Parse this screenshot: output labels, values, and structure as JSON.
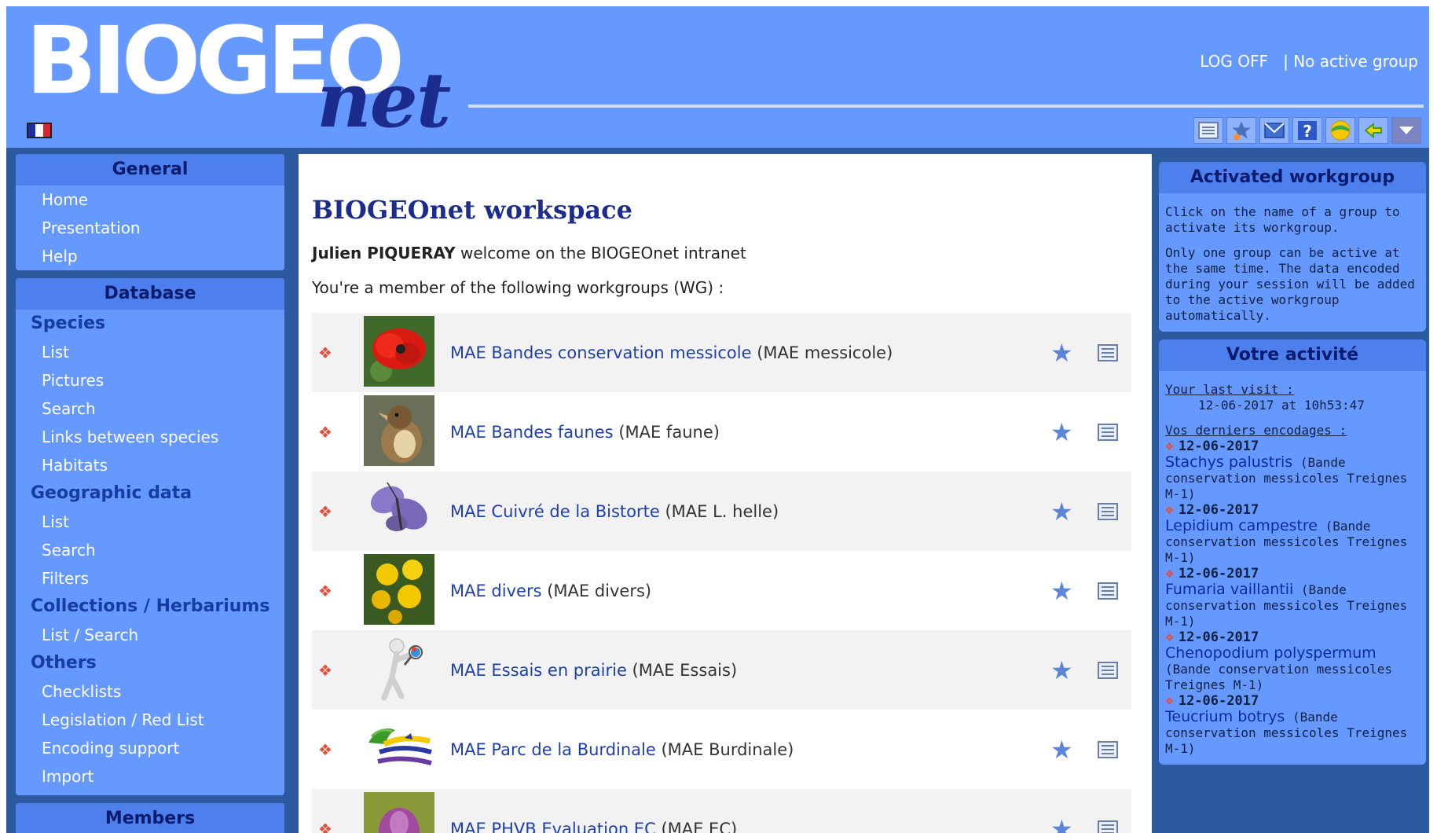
{
  "header": {
    "logo_main": "BIOGEO",
    "logo_sub": "net",
    "logoff": "LOG OFF",
    "separator": "|",
    "active_group": "No active group",
    "toolbar_icons": [
      "list-icon",
      "favorite-star-icon",
      "mail-icon",
      "help-icon",
      "globe-icon",
      "back-arrow-icon",
      "dropdown-arrow-icon"
    ]
  },
  "sidebar": {
    "general": {
      "title": "General",
      "items": [
        "Home",
        "Presentation",
        "Help"
      ]
    },
    "database": {
      "title": "Database",
      "sections": [
        {
          "label": "Species",
          "items": [
            "List",
            "Pictures",
            "Search",
            "Links between species",
            "Habitats"
          ]
        },
        {
          "label": "Geographic data",
          "items": [
            "List",
            "Search",
            "Filters"
          ]
        },
        {
          "label": "Collections / Herbariums",
          "items": [
            "List / Search"
          ]
        },
        {
          "label": "Others",
          "items": [
            "Checklists",
            "Legislation / Red List",
            "Encoding support",
            "Import"
          ]
        }
      ]
    },
    "members": {
      "title": "Members"
    }
  },
  "main": {
    "title": "BIOGEOnet workspace",
    "user_name": "Julien PIQUERAY",
    "welcome_text": "welcome on the BIOGEOnet intranet",
    "member_text": "You're a member of the following workgroups (WG) :",
    "workgroups": [
      {
        "name": "MAE Bandes conservation messicole",
        "alias": "(MAE messicole)"
      },
      {
        "name": "MAE Bandes faunes",
        "alias": "(MAE faune)"
      },
      {
        "name": "MAE Cuivré de la Bistorte",
        "alias": "(MAE L. helle)"
      },
      {
        "name": "MAE divers",
        "alias": "(MAE divers)"
      },
      {
        "name": "MAE Essais en prairie",
        "alias": "(MAE Essais)"
      },
      {
        "name": "MAE Parc de la Burdinale",
        "alias": "(MAE Burdinale)"
      },
      {
        "name": "MAE PHVB Evaluation EC",
        "alias": "(MAE EC)"
      }
    ]
  },
  "right": {
    "activated": {
      "title": "Activated workgroup",
      "p1": "Click on the name of a group to activate its workgroup.",
      "p2": "Only one group can be active at the same time. The data encoded during your session will be added to the active workgroup automatically."
    },
    "activity": {
      "title": "Votre activité",
      "last_visit_label": "Your last visit :",
      "last_visit_value": "12-06-2017 at 10h53:47",
      "encodings_label": "Vos derniers encodages :",
      "encodings": [
        {
          "date": "12-06-2017",
          "species": "Stachys palustris",
          "group": "(Bande conservation messicoles Treignes M-1)"
        },
        {
          "date": "12-06-2017",
          "species": "Lepidium campestre",
          "group": "(Bande conservation messicoles Treignes M-1)"
        },
        {
          "date": "12-06-2017",
          "species": "Fumaria vaillantii",
          "group": "(Bande conservation messicoles Treignes M-1)"
        },
        {
          "date": "12-06-2017",
          "species": "Chenopodium polyspermum",
          "group": "(Bande conservation messicoles Treignes M-1)"
        },
        {
          "date": "12-06-2017",
          "species": "Teucrium botrys",
          "group": "(Bande conservation messicoles Treignes M-1)"
        }
      ]
    }
  },
  "colors": {
    "header_bg": "#6699ff",
    "menu_title_bg": "#4d80ec",
    "link": "#1d3fb0",
    "title": "#1c2c8c"
  }
}
